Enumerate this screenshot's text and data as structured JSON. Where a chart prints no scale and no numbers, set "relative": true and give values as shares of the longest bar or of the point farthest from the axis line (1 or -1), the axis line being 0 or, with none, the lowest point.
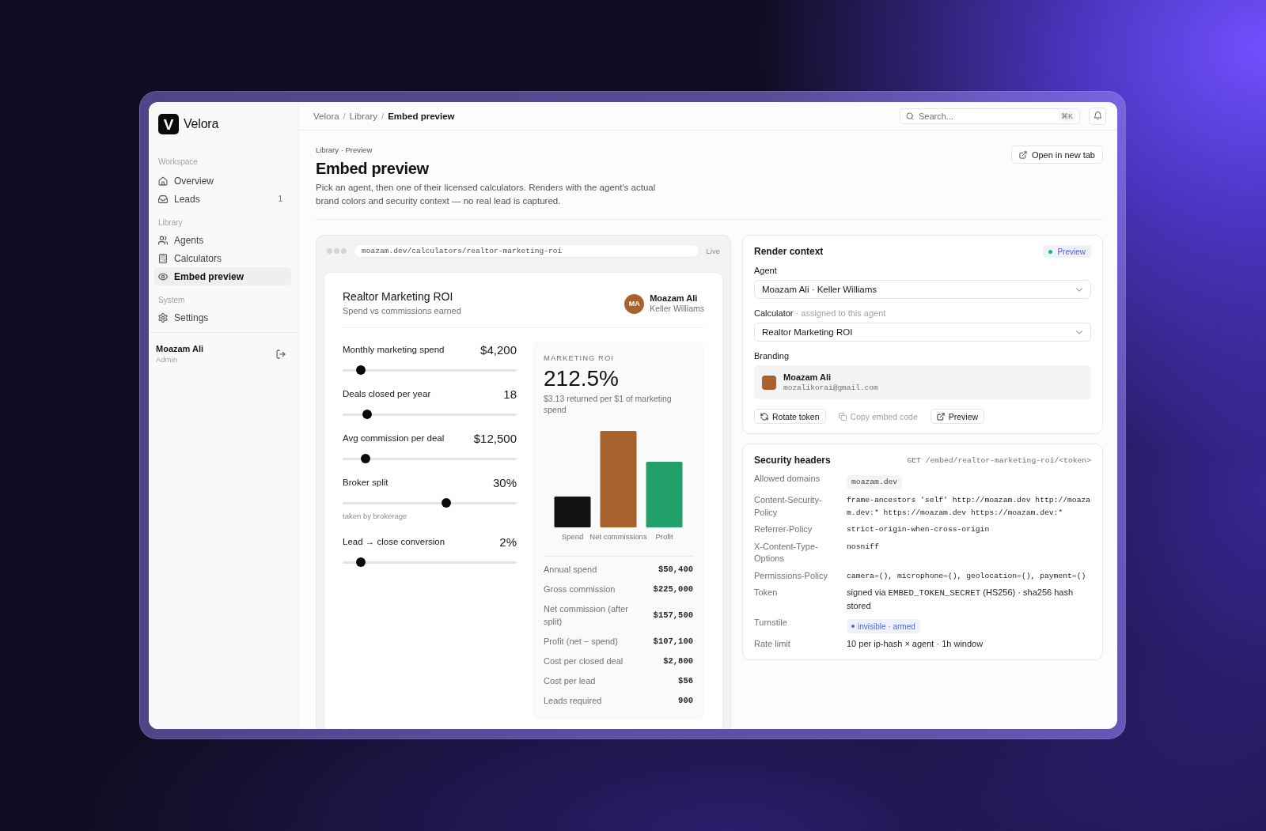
{
  "brand": {
    "logo_mark": "V",
    "name": "Velora"
  },
  "sidebar": {
    "sections": [
      {
        "title": "Workspace",
        "items": [
          {
            "label": "Overview",
            "selected": false
          },
          {
            "label": "Leads",
            "count": "1",
            "selected": false
          }
        ]
      },
      {
        "title": "Library",
        "items": [
          {
            "label": "Agents",
            "selected": false
          },
          {
            "label": "Calculators",
            "selected": false
          },
          {
            "label": "Embed preview",
            "selected": true
          }
        ]
      },
      {
        "title": "System",
        "items": [
          {
            "label": "Settings",
            "selected": false
          }
        ]
      }
    ],
    "user": {
      "name": "Moazam Ali",
      "role": "Admin"
    }
  },
  "topbar": {
    "breadcrumb": [
      "Velora",
      "Library",
      "Embed preview"
    ],
    "separator": "/",
    "search": {
      "placeholder": "Search...",
      "shortcut": "⌘K"
    }
  },
  "page": {
    "eyebrow": "Library · Preview",
    "title": "Embed preview",
    "description": "Pick an agent, then one of their licensed calculators. Renders with the agent's actual brand colors and security context — no real lead is captured.",
    "action": "Open in new tab"
  },
  "preview": {
    "url": "moazam.dev/calculators/realtor-marketing-roi",
    "status": "Live",
    "calculator": {
      "title": "Realtor Marketing ROI",
      "subtitle": "Spend vs commissions earned",
      "agent": {
        "initials": "MA",
        "name": "Moazam Ali",
        "company": "Keller Williams"
      },
      "inputs": [
        {
          "label": "Monthly marketing spend",
          "value": "$4,200",
          "level": 0.08
        },
        {
          "label": "Deals closed per year",
          "value": "18",
          "level": 0.12
        },
        {
          "label": "Avg commission per deal",
          "value": "$12,500",
          "level": 0.11
        },
        {
          "label": "Broker split",
          "value": "30%",
          "level": 0.6,
          "hint": "taken by brokerage"
        },
        {
          "label": "Lead → close conversion",
          "value": "2%",
          "level": 0.08
        }
      ],
      "result": {
        "label": "MARKETING ROI",
        "value": "212.5%",
        "caption": "$3.13 returned per $1 of marketing spend",
        "chart_data": {
          "type": "bar",
          "relative": true,
          "categories": [
            "Spend",
            "Net commissions",
            "Profit"
          ],
          "values": [
            0.32,
            1,
            0.68
          ],
          "colors": [
            "#111111",
            "#a8622d",
            "#21a06c"
          ]
        },
        "stats": [
          {
            "label": "Annual spend",
            "value": "$50,400"
          },
          {
            "label": "Gross commission",
            "value": "$225,000"
          },
          {
            "label": "Net commission (after split)",
            "value": "$157,500"
          },
          {
            "label": "Profit (net − spend)",
            "value": "$107,100"
          },
          {
            "label": "Cost per closed deal",
            "value": "$2,800"
          },
          {
            "label": "Cost per lead",
            "value": "$56"
          },
          {
            "label": "Leads required",
            "value": "900"
          }
        ]
      }
    }
  },
  "render_context": {
    "title": "Render context",
    "badge": "Preview",
    "fields": [
      {
        "label": "Agent",
        "value": "Moazam Ali · Keller Williams"
      },
      {
        "label": "Calculator",
        "note": "· assigned to this agent",
        "value": "Realtor Marketing ROI"
      }
    ],
    "branding": {
      "label": "Branding",
      "name": "Moazam Ali",
      "email": "mozalikorai@gmail.com"
    },
    "actions": [
      {
        "label": "Rotate token",
        "disabled": false
      },
      {
        "label": "Copy embed code",
        "disabled": true
      },
      {
        "label": "Preview",
        "disabled": false
      }
    ]
  },
  "security_headers": {
    "title": "Security headers",
    "endpoint": "GET /embed/realtor-marketing-roi/<token>",
    "rows": [
      {
        "key": "Allowed domains",
        "kind": "tag",
        "value": "moazam.dev"
      },
      {
        "key": "Content-Security-Policy",
        "kind": "code",
        "value": "frame-ancestors 'self' http://moazam.dev http://moazam.dev:* https://moazam.dev https://moazam.dev:*"
      },
      {
        "key": "Referrer-Policy",
        "kind": "code",
        "value": "strict-origin-when-cross-origin"
      },
      {
        "key": "X-Content-Type-Options",
        "kind": "code",
        "value": "nosniff"
      },
      {
        "key": "Permissions-Policy",
        "kind": "code",
        "value": "camera=(), microphone=(), geolocation=(), payment=()"
      },
      {
        "key": "Token",
        "kind": "mixed",
        "parts": [
          {
            "kind": "text",
            "text": "signed via "
          },
          {
            "kind": "code",
            "text": "EMBED_TOKEN_SECRET"
          },
          {
            "kind": "text",
            "text": " (HS256) · sha256 hash stored"
          }
        ]
      },
      {
        "key": "Turnstile",
        "kind": "status",
        "value": "invisible · armed"
      },
      {
        "key": "Rate limit",
        "kind": "text",
        "value": "10 per ip-hash × agent · 1h window"
      }
    ]
  }
}
